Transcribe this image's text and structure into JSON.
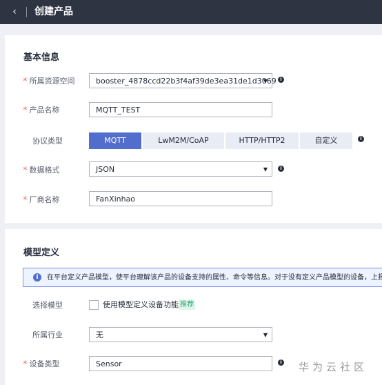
{
  "header": {
    "back_icon": "‹",
    "title": "创建产品"
  },
  "basic": {
    "title": "基本信息",
    "resource_space": {
      "label": "所属资源空间",
      "value": "booster_4878ccd22b3f4af39de3ea31de1d3069"
    },
    "product_name": {
      "label": "产品名称",
      "value": "MQTT_TEST"
    },
    "protocol": {
      "label": "协议类型",
      "options": [
        "MQTT",
        "LwM2M/CoAP",
        "HTTP/HTTP2",
        "自定义"
      ],
      "selected": "MQTT"
    },
    "data_format": {
      "label": "数据格式",
      "value": "JSON"
    },
    "vendor": {
      "label": "厂商名称",
      "value": "FanXinhao"
    }
  },
  "model": {
    "title": "模型定义",
    "notice_icon": "i",
    "notice": "在平台定义产品模型，使平台理解该产品的设备支持的属性、命令等信息。对于没有定义产品模型的设备，上报的",
    "select_model": {
      "label": "选择模型",
      "checkbox_label": "使用模型定义设备功能",
      "checked": false,
      "tag": "推荐"
    },
    "industry": {
      "label": "所属行业",
      "value": "无"
    },
    "device_type": {
      "label": "设备类型",
      "value": "Sensor"
    }
  },
  "watermark": "华为云社区",
  "colors": {
    "topbar": "#2f3443",
    "accent": "#526ecc",
    "required": "#f66f6a",
    "tag_green": "#2fa87a"
  }
}
